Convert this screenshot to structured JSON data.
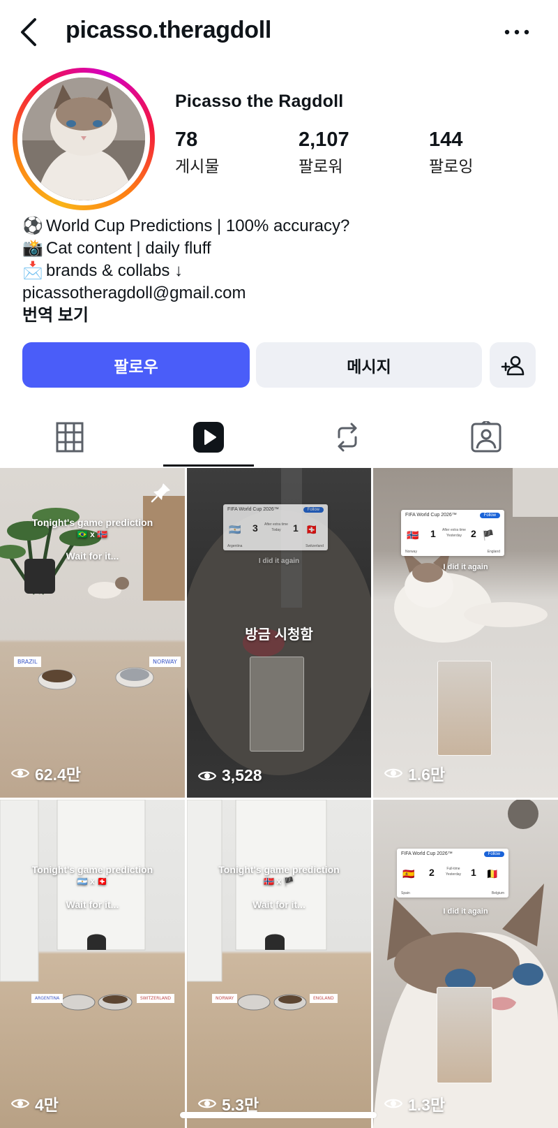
{
  "header": {
    "username": "picasso.theragdoll",
    "back_icon": "chevron-left-icon",
    "more_icon": "more-horizontal-icon"
  },
  "profile": {
    "display_name": "Picasso the Ragdoll",
    "stats": [
      {
        "value": "78",
        "label": "게시물"
      },
      {
        "value": "2,107",
        "label": "팔로워"
      },
      {
        "value": "144",
        "label": "팔로잉"
      }
    ],
    "bio": [
      {
        "emoji": "⚽️",
        "text": "World Cup Predictions | 100% accuracy?"
      },
      {
        "emoji": "📸",
        "text": "Cat content | daily fluff"
      },
      {
        "emoji": "📩",
        "text": "brands & collabs ↓"
      }
    ],
    "email": "picassotheragdoll@gmail.com",
    "translate_label": "번역 보기"
  },
  "actions": {
    "follow_label": "팔로우",
    "message_label": "메시지",
    "suggest_icon": "add-person-icon",
    "follow_color": "#4a5df9"
  },
  "tabs": [
    {
      "icon": "grid-icon",
      "active": false
    },
    {
      "icon": "reels-icon",
      "active": true
    },
    {
      "icon": "reposts-icon",
      "active": false
    },
    {
      "icon": "tagged-icon",
      "active": false
    }
  ],
  "reels": [
    {
      "views": "62.4만",
      "pinned": true,
      "caption": "Tonight's game prediction",
      "flags": "🇧🇷 x 🇳🇴",
      "subcaption": "Wait for it...",
      "placards": [
        "BRAZIL",
        "NORWAY"
      ]
    },
    {
      "views": "3,528",
      "watched_label": "방금 시청함",
      "card": {
        "title": "FIFA World Cup 2026™",
        "follow": "Follow",
        "home": "Argentina",
        "home_score": "3",
        "away": "Switzerland",
        "away_score": "1",
        "status": "After extra time",
        "when": "Today"
      },
      "caption": "I did it again"
    },
    {
      "views": "1.6만",
      "card": {
        "title": "FIFA World Cup 2026™",
        "follow": "Follow",
        "home": "Norway",
        "home_score": "1",
        "away": "England",
        "away_score": "2",
        "status": "After extra time",
        "when": "Yesterday"
      },
      "caption": "I did it again"
    },
    {
      "views": "4만",
      "caption": "Tonight's game prediction",
      "flags": "🇦🇷 x 🇨🇭",
      "subcaption": "Wait for it...",
      "placards": [
        "ARGENTINA",
        "SWITZERLAND"
      ]
    },
    {
      "views": "5.3만",
      "caption": "Tonight's game prediction",
      "flags": "🇳🇴 x 🏴",
      "subcaption": "Wait for it...",
      "placards": [
        "NORWAY",
        "ENGLAND"
      ]
    },
    {
      "views": "1.3만",
      "card": {
        "title": "FIFA World Cup 2026™",
        "follow": "Follow",
        "home": "Spain",
        "home_score": "2",
        "away": "Belgium",
        "away_score": "1",
        "status": "Full-time",
        "when": "Yesterday"
      },
      "caption": "I did it again"
    }
  ]
}
